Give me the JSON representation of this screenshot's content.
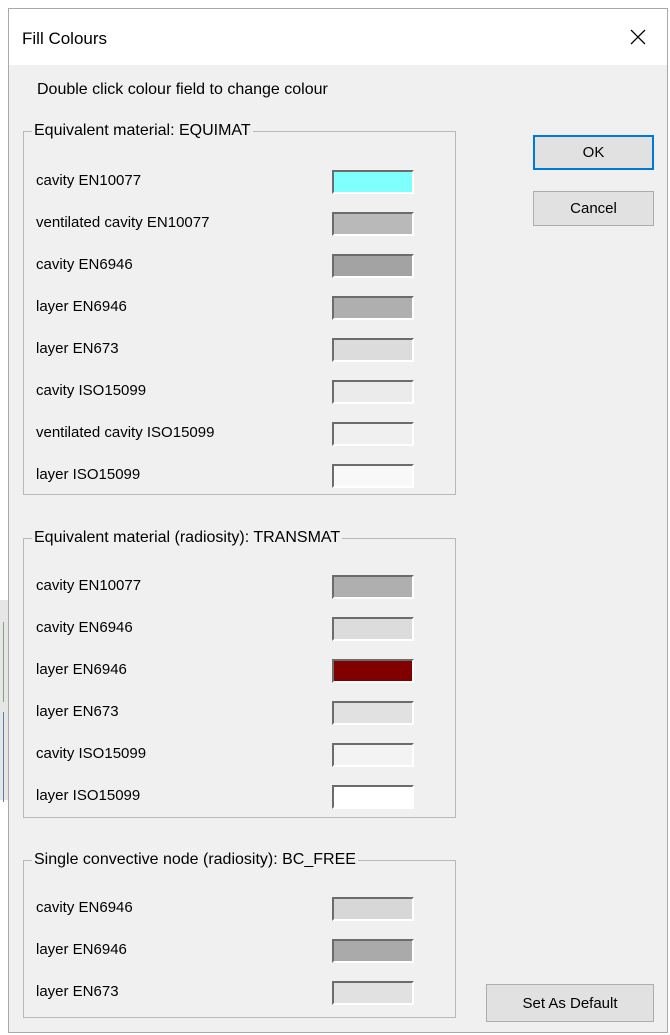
{
  "dialog": {
    "title": "Fill Colours",
    "close_glyph": "✕",
    "instructions": "Double click colour field to change colour"
  },
  "groups": [
    {
      "legend": "Equivalent material: EQUIMAT",
      "items": [
        {
          "label": "cavity EN10077",
          "color": "#80ffff"
        },
        {
          "label": "ventilated cavity EN10077",
          "color": "#b9b9b9"
        },
        {
          "label": "cavity EN6946",
          "color": "#a3a3a3"
        },
        {
          "label": "layer EN6946",
          "color": "#afafaf"
        },
        {
          "label": "layer EN673",
          "color": "#dcdcdc"
        },
        {
          "label": "cavity ISO15099",
          "color": "#ebebeb"
        },
        {
          "label": "ventilated cavity ISO15099",
          "color": "#f0f0f0"
        },
        {
          "label": "layer ISO15099",
          "color": "#f8f8f8"
        }
      ]
    },
    {
      "legend": "Equivalent material (radiosity): TRANSMAT",
      "items": [
        {
          "label": "cavity EN10077",
          "color": "#afafaf"
        },
        {
          "label": "cavity EN6946",
          "color": "#dcdcdc"
        },
        {
          "label": "layer EN6946",
          "color": "#800000"
        },
        {
          "label": "layer EN673",
          "color": "#e1e1e1"
        },
        {
          "label": "cavity ISO15099",
          "color": "#f3f3f3"
        },
        {
          "label": "layer ISO15099",
          "color": "#ffffff"
        }
      ]
    },
    {
      "legend": "Single convective node (radiosity): BC_FREE",
      "items": [
        {
          "label": "cavity EN6946",
          "color": "#d7d7d7"
        },
        {
          "label": "layer EN6946",
          "color": "#aaaaaa"
        },
        {
          "label": "layer EN673",
          "color": "#e1e1e1"
        }
      ]
    }
  ],
  "buttons": {
    "ok": "OK",
    "cancel": "Cancel",
    "set_default": "Set As Default"
  }
}
